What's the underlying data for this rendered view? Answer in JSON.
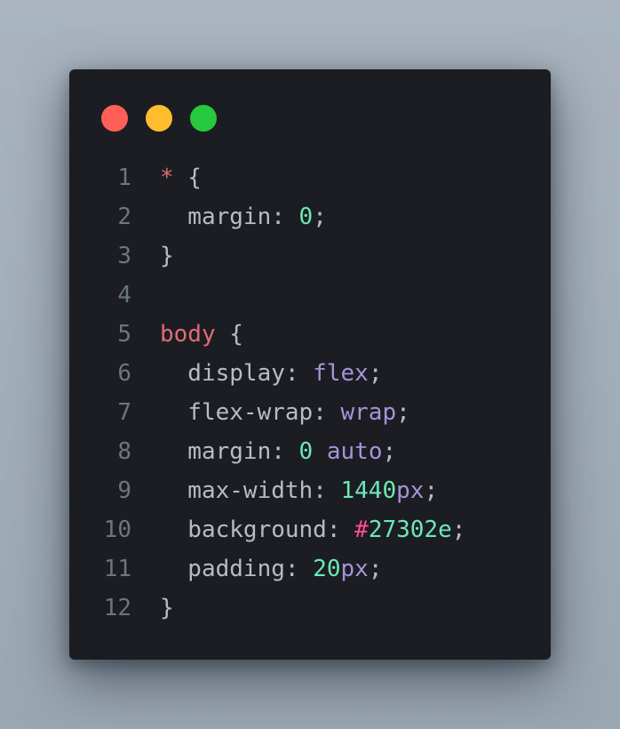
{
  "window": {
    "traffic_lights": [
      {
        "name": "close",
        "color": "#ff5f56"
      },
      {
        "name": "minimize",
        "color": "#ffbd2e"
      },
      {
        "name": "maximize",
        "color": "#27c93f"
      }
    ]
  },
  "colors": {
    "background": "#a2aeb8",
    "editor_background": "#1b1d22",
    "line_number": "#6c7680",
    "selector": "#e06c75",
    "property": "#b7bcc4",
    "keyword": "#a594d8",
    "number": "#6ee7b7",
    "hash": "#ff4d8d"
  },
  "code": {
    "lines": [
      {
        "number": "1",
        "tokens": [
          {
            "t": "*",
            "c": "sel"
          },
          {
            "t": " {",
            "c": "punc"
          }
        ]
      },
      {
        "number": "2",
        "tokens": [
          {
            "t": "  margin",
            "c": "prop"
          },
          {
            "t": ": ",
            "c": "punc"
          },
          {
            "t": "0",
            "c": "num"
          },
          {
            "t": ";",
            "c": "punc"
          }
        ]
      },
      {
        "number": "3",
        "tokens": [
          {
            "t": "}",
            "c": "punc"
          }
        ]
      },
      {
        "number": "4",
        "tokens": []
      },
      {
        "number": "5",
        "tokens": [
          {
            "t": "body",
            "c": "sel"
          },
          {
            "t": " {",
            "c": "punc"
          }
        ]
      },
      {
        "number": "6",
        "tokens": [
          {
            "t": "  display",
            "c": "prop"
          },
          {
            "t": ": ",
            "c": "punc"
          },
          {
            "t": "flex",
            "c": "kw"
          },
          {
            "t": ";",
            "c": "punc"
          }
        ]
      },
      {
        "number": "7",
        "tokens": [
          {
            "t": "  flex-wrap",
            "c": "prop"
          },
          {
            "t": ": ",
            "c": "punc"
          },
          {
            "t": "wrap",
            "c": "kw"
          },
          {
            "t": ";",
            "c": "punc"
          }
        ]
      },
      {
        "number": "8",
        "tokens": [
          {
            "t": "  margin",
            "c": "prop"
          },
          {
            "t": ": ",
            "c": "punc"
          },
          {
            "t": "0",
            "c": "num"
          },
          {
            "t": " ",
            "c": "punc"
          },
          {
            "t": "auto",
            "c": "kw"
          },
          {
            "t": ";",
            "c": "punc"
          }
        ]
      },
      {
        "number": "9",
        "tokens": [
          {
            "t": "  max-width",
            "c": "prop"
          },
          {
            "t": ": ",
            "c": "punc"
          },
          {
            "t": "1440",
            "c": "num"
          },
          {
            "t": "px",
            "c": "kw"
          },
          {
            "t": ";",
            "c": "punc"
          }
        ]
      },
      {
        "number": "10",
        "tokens": [
          {
            "t": "  background",
            "c": "prop"
          },
          {
            "t": ": ",
            "c": "punc"
          },
          {
            "t": "#",
            "c": "hash"
          },
          {
            "t": "27302e",
            "c": "num"
          },
          {
            "t": ";",
            "c": "punc"
          }
        ]
      },
      {
        "number": "11",
        "tokens": [
          {
            "t": "  padding",
            "c": "prop"
          },
          {
            "t": ": ",
            "c": "punc"
          },
          {
            "t": "20",
            "c": "num"
          },
          {
            "t": "px",
            "c": "kw"
          },
          {
            "t": ";",
            "c": "punc"
          }
        ]
      },
      {
        "number": "12",
        "tokens": [
          {
            "t": "}",
            "c": "punc"
          }
        ]
      }
    ]
  }
}
